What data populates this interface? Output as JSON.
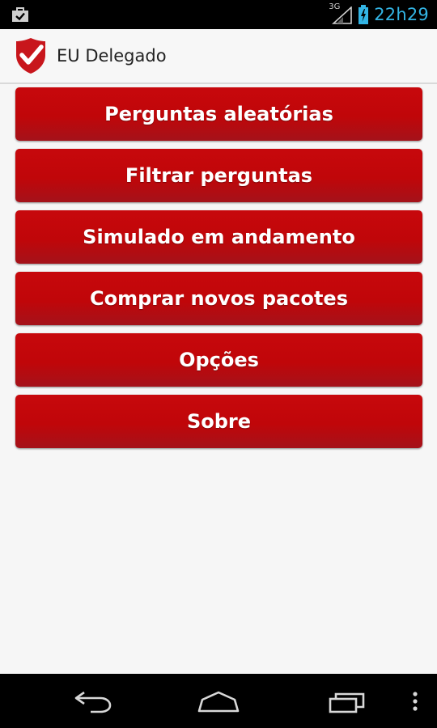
{
  "status_bar": {
    "network_type": "3G",
    "time": "22h29",
    "icons": [
      "shopping-bag-check-icon",
      "signal-icon",
      "battery-charging-icon"
    ]
  },
  "action_bar": {
    "title": "EU Delegado",
    "logo_icon": "shield-check-logo"
  },
  "menu": {
    "buttons": [
      {
        "label": "Perguntas aleatórias"
      },
      {
        "label": "Filtrar perguntas"
      },
      {
        "label": "Simulado em andamento"
      },
      {
        "label": "Comprar novos pacotes"
      },
      {
        "label": "Opções"
      },
      {
        "label": "Sobre"
      }
    ]
  },
  "nav_bar": {
    "icons": [
      "back-icon",
      "home-icon",
      "recents-icon",
      "overflow-menu-icon"
    ]
  },
  "colors": {
    "button_red": "#c00609",
    "button_red_dark": "#a4121a",
    "status_blue": "#33b5e5",
    "background": "#f6f6f6"
  }
}
